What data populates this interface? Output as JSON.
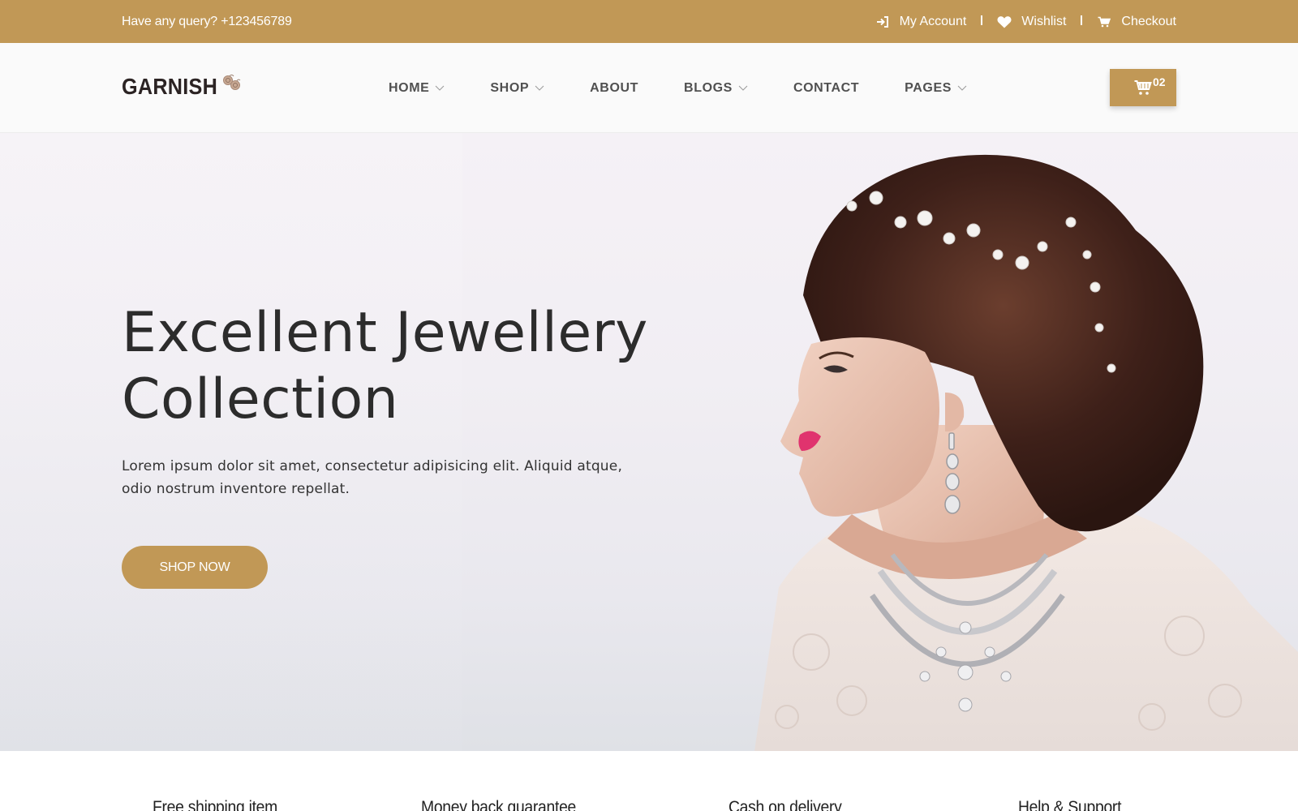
{
  "topbar": {
    "query": "Have any query? +123456789",
    "links": [
      {
        "label": "My Account",
        "icon": "sign-in-icon"
      },
      {
        "label": "Wishlist",
        "icon": "heart-icon"
      },
      {
        "label": "Checkout",
        "icon": "cart-icon"
      }
    ]
  },
  "header": {
    "logo": "GARNISH",
    "nav": [
      {
        "label": "HOME",
        "has_dropdown": true
      },
      {
        "label": "SHOP",
        "has_dropdown": true
      },
      {
        "label": "ABOUT",
        "has_dropdown": false
      },
      {
        "label": "BLOGS",
        "has_dropdown": true
      },
      {
        "label": "CONTACT",
        "has_dropdown": false
      },
      {
        "label": "PAGES",
        "has_dropdown": true
      }
    ],
    "cart_count": "02"
  },
  "hero": {
    "title_line1": "Excellent Jewellery",
    "title_line2": "Collection",
    "description": "Lorem ipsum dolor sit amet, consectetur adipisicing elit. Aliquid atque, odio nostrum inventore repellat.",
    "cta": "SHOP NOW",
    "image_alt": "Woman wearing bridal hair vine, drop earring and statement necklace"
  },
  "features": [
    "Free shipping item",
    "Money back guarantee",
    "Cash on delivery",
    "Help & Support"
  ],
  "colors": {
    "accent": "#c19856",
    "heading": "#2c2c2c",
    "nav_text": "#505050",
    "header_bg": "#fafafa"
  }
}
